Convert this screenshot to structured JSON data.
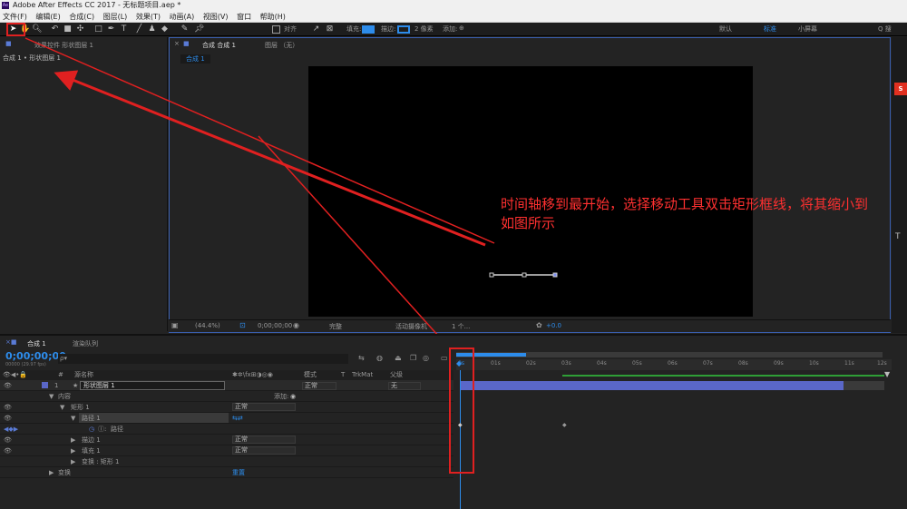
{
  "app": {
    "title": "Adobe After Effects CC 2017 - 无标题项目.aep *",
    "logo": "Ae"
  },
  "menu": [
    "文件(F)",
    "编辑(E)",
    "合成(C)",
    "图层(L)",
    "效果(T)",
    "动画(A)",
    "视图(V)",
    "窗口",
    "帮助(H)"
  ],
  "toolbar": {
    "snap_label": "对齐",
    "fill_label": "填充:",
    "stroke_label": "描边:",
    "stroke_width": "2 像素",
    "add_label": "添加:",
    "workspace_default": "默认",
    "workspace_standard": "标准",
    "workspace_small": "小屏幕",
    "search_label": "Q 搜"
  },
  "left_panel": {
    "tab": "效果控件 形状图层 1",
    "breadcrumb": "合成 1 • 形状图层 1"
  },
  "comp_panel": {
    "tab": "合成 合成 1",
    "layer_tab": "图层 （无）",
    "comp_chip": "合成 1"
  },
  "viewer_bar": {
    "zoom": "(44.4%)",
    "timecode": "0;00;00;00",
    "quality": "完整",
    "camera": "活动摄像机",
    "views": "1 个...",
    "exposure": "+0.0"
  },
  "annotation": {
    "text": "时间轴移到最开始，选择移动工具双击矩形框线，将其缩小到如图所示",
    "color": "#ff3030"
  },
  "timeline": {
    "tab_comp": "合成 1",
    "tab_render": "渲染队列",
    "timecode": "0;00;00;00",
    "fps": "00000 (29.97 fps)",
    "search_placeholder": "ρ▾",
    "col_source": "源名称",
    "col_mode": "模式",
    "col_t": "T",
    "col_trkmat": "TrkMat",
    "col_parent": "父级",
    "layer": {
      "index": "1",
      "name": "形状图层 1",
      "mode": "正常",
      "parent": "无"
    },
    "rows": [
      {
        "label": "内容",
        "add": "添加:"
      },
      {
        "label": "矩形 1",
        "mode": "正常"
      },
      {
        "label": "路径 1"
      },
      {
        "label": "路径"
      },
      {
        "label": "描边 1",
        "mode": "正常"
      },
      {
        "label": "填充 1",
        "mode": "正常"
      },
      {
        "label": "变换 : 矩形 1"
      },
      {
        "label": "变换",
        "reset": "重置"
      }
    ],
    "ticks": [
      "0s",
      "01s",
      "02s",
      "03s",
      "04s",
      "05s",
      "06s",
      "07s",
      "08s",
      "09s",
      "10s",
      "11s",
      "12s"
    ]
  },
  "colors": {
    "accent": "#2d8ceb",
    "highlight": "#e02020",
    "layerbar": "#5a67c8",
    "green": "#2e9e36"
  }
}
